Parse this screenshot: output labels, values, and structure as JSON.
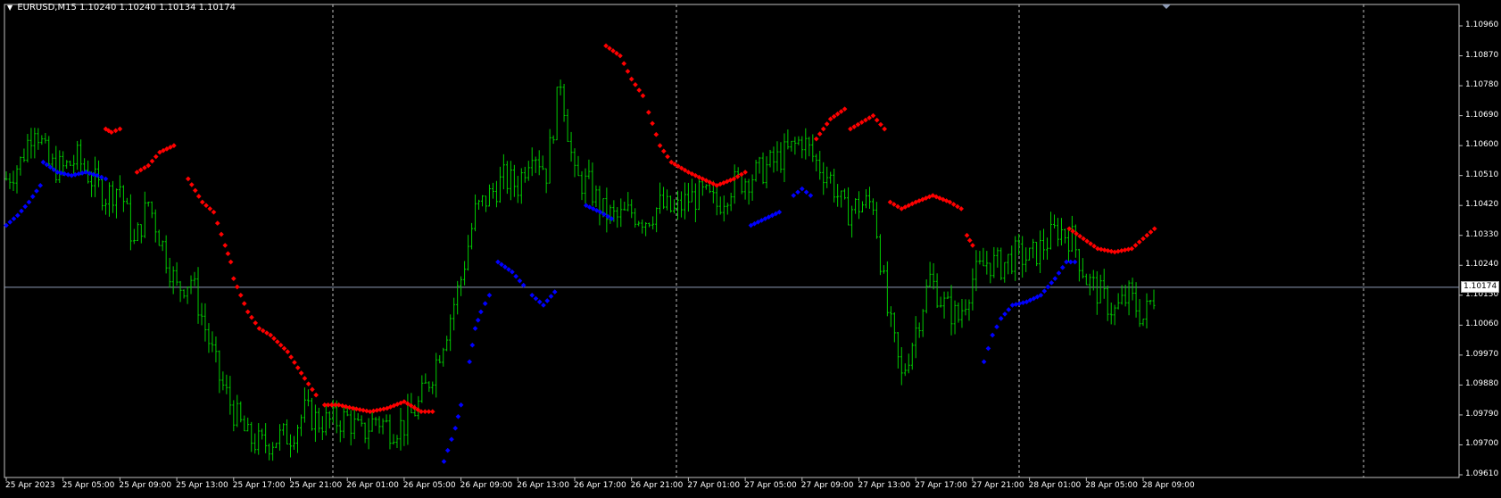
{
  "header": {
    "symbol_timeframe": "EURUSD,M15",
    "ohlc": "1.10240 1.10240 1.10134 1.10174"
  },
  "colors": {
    "background": "#000000",
    "frame": "#c0c0c0",
    "grid": "#c0c0c0",
    "bull_bars": "#00cc00",
    "dots_above": "#ff0000",
    "dots_below": "#0000ff",
    "price_line": "#8e9bb5"
  },
  "icons": {
    "collapse": "triangle-down-icon",
    "shift_marker": "triangle-down-icon"
  },
  "current_price": "1.10174",
  "price_axis": [
    "1.10960",
    "1.10870",
    "1.10780",
    "1.10690",
    "1.10600",
    "1.10510",
    "1.10420",
    "1.10330",
    "1.10240",
    "1.10150",
    "1.10060",
    "1.09970",
    "1.09880",
    "1.09790",
    "1.09700",
    "1.09610"
  ],
  "time_axis": [
    "25 Apr 2023",
    "25 Apr 05:00",
    "25 Apr 09:00",
    "25 Apr 13:00",
    "25 Apr 17:00",
    "25 Apr 21:00",
    "26 Apr 01:00",
    "26 Apr 05:00",
    "26 Apr 09:00",
    "26 Apr 13:00",
    "26 Apr 17:00",
    "26 Apr 21:00",
    "27 Apr 01:00",
    "27 Apr 05:00",
    "27 Apr 09:00",
    "27 Apr 13:00",
    "27 Apr 17:00",
    "27 Apr 21:00",
    "28 Apr 01:00",
    "28 Apr 05:00",
    "28 Apr 09:00"
  ],
  "chart_data": {
    "type": "line",
    "title": "EURUSD,M15",
    "ylim": [
      1.0961,
      1.1099
    ],
    "grid": false,
    "close_series": [
      {
        "t": 0,
        "v": 1.105
      },
      {
        "t": 0.5,
        "v": 1.1055
      },
      {
        "t": 1,
        "v": 1.1067
      },
      {
        "t": 1.5,
        "v": 1.1054
      },
      {
        "t": 2,
        "v": 1.1053
      },
      {
        "t": 2.5,
        "v": 1.1056
      },
      {
        "t": 3,
        "v": 1.105
      },
      {
        "t": 3.5,
        "v": 1.1045
      },
      {
        "t": 4,
        "v": 1.1048
      },
      {
        "t": 4.5,
        "v": 1.103
      },
      {
        "t": 5,
        "v": 1.1043
      },
      {
        "t": 5.5,
        "v": 1.103
      },
      {
        "t": 6,
        "v": 1.1017
      },
      {
        "t": 6.5,
        "v": 1.102
      },
      {
        "t": 7,
        "v": 1.1005
      },
      {
        "t": 7.5,
        "v": 1.099
      },
      {
        "t": 8,
        "v": 1.098
      },
      {
        "t": 8.5,
        "v": 1.0972
      },
      {
        "t": 9,
        "v": 1.097
      },
      {
        "t": 9.5,
        "v": 1.0972
      },
      {
        "t": 10,
        "v": 1.0973
      },
      {
        "t": 10.5,
        "v": 1.098
      },
      {
        "t": 11,
        "v": 1.0977
      },
      {
        "t": 11.5,
        "v": 1.0977
      },
      {
        "t": 12,
        "v": 1.0978
      },
      {
        "t": 12.5,
        "v": 1.0973
      },
      {
        "t": 13,
        "v": 1.0978
      },
      {
        "t": 13.5,
        "v": 1.0975
      },
      {
        "t": 14,
        "v": 1.0976
      },
      {
        "t": 14.5,
        "v": 1.0982
      },
      {
        "t": 15,
        "v": 1.0992
      },
      {
        "t": 15.5,
        "v": 1.1005
      },
      {
        "t": 16,
        "v": 1.102
      },
      {
        "t": 16.5,
        "v": 1.104
      },
      {
        "t": 17,
        "v": 1.1045
      },
      {
        "t": 17.5,
        "v": 1.105
      },
      {
        "t": 18,
        "v": 1.1048
      },
      {
        "t": 18.5,
        "v": 1.106
      },
      {
        "t": 19,
        "v": 1.1052
      },
      {
        "t": 19.5,
        "v": 1.108
      },
      {
        "t": 20,
        "v": 1.105
      },
      {
        "t": 20.5,
        "v": 1.1048
      },
      {
        "t": 21,
        "v": 1.104
      },
      {
        "t": 21.5,
        "v": 1.1038
      },
      {
        "t": 22,
        "v": 1.104
      },
      {
        "t": 22.5,
        "v": 1.1038
      },
      {
        "t": 23,
        "v": 1.1042
      },
      {
        "t": 23.5,
        "v": 1.104
      },
      {
        "t": 24,
        "v": 1.1044
      },
      {
        "t": 24.5,
        "v": 1.1045
      },
      {
        "t": 25,
        "v": 1.1042
      },
      {
        "t": 25.5,
        "v": 1.1048
      },
      {
        "t": 26,
        "v": 1.105
      },
      {
        "t": 26.5,
        "v": 1.1052
      },
      {
        "t": 27,
        "v": 1.1055
      },
      {
        "t": 27.5,
        "v": 1.1058
      },
      {
        "t": 28,
        "v": 1.1062
      },
      {
        "t": 28.5,
        "v": 1.1055
      },
      {
        "t": 29,
        "v": 1.105
      },
      {
        "t": 29.5,
        "v": 1.104
      },
      {
        "t": 30,
        "v": 1.1042
      },
      {
        "t": 30.5,
        "v": 1.1043
      },
      {
        "t": 31,
        "v": 1.101
      },
      {
        "t": 31.5,
        "v": 1.099
      },
      {
        "t": 32,
        "v": 1.1005
      },
      {
        "t": 32.5,
        "v": 1.102
      },
      {
        "t": 33,
        "v": 1.1012
      },
      {
        "t": 33.5,
        "v": 1.1008
      },
      {
        "t": 34,
        "v": 1.102
      },
      {
        "t": 34.5,
        "v": 1.1025
      },
      {
        "t": 35,
        "v": 1.1024
      },
      {
        "t": 35.5,
        "v": 1.1027
      },
      {
        "t": 36,
        "v": 1.1026
      },
      {
        "t": 36.5,
        "v": 1.103
      },
      {
        "t": 37,
        "v": 1.1035
      },
      {
        "t": 37.5,
        "v": 1.1032
      },
      {
        "t": 38,
        "v": 1.102
      },
      {
        "t": 38.5,
        "v": 1.1015
      },
      {
        "t": 39,
        "v": 1.101
      },
      {
        "t": 39.5,
        "v": 1.1015
      },
      {
        "t": 40,
        "v": 1.1008
      },
      {
        "t": 40.5,
        "v": 1.1017
      }
    ],
    "upper_dots": [
      [
        [
          3.5,
          1.1065
        ],
        [
          3.7,
          1.1064
        ],
        [
          4,
          1.1065
        ]
      ],
      [
        [
          4.6,
          1.1052
        ],
        [
          5,
          1.1054
        ],
        [
          5.4,
          1.1058
        ],
        [
          5.9,
          1.106
        ]
      ],
      [
        [
          6.4,
          1.105
        ],
        [
          6.9,
          1.1043
        ],
        [
          7.3,
          1.104
        ],
        [
          7.7,
          1.103
        ],
        [
          7.9,
          1.1025
        ]
      ],
      [
        [
          8.0,
          1.102
        ],
        [
          8.5,
          1.101
        ],
        [
          8.9,
          1.1005
        ],
        [
          9.3,
          1.1003
        ],
        [
          9.9,
          1.0998
        ],
        [
          10.5,
          1.099
        ],
        [
          10.9,
          1.0985
        ]
      ],
      [
        [
          11.2,
          1.0982
        ],
        [
          11.7,
          1.0982
        ],
        [
          12.2,
          1.0981
        ],
        [
          12.8,
          1.098
        ],
        [
          13.4,
          1.0981
        ],
        [
          14.0,
          1.0983
        ],
        [
          14.6,
          1.098
        ],
        [
          15.0,
          1.098
        ]
      ],
      [
        [
          21.1,
          1.109
        ],
        [
          21.6,
          1.1087
        ],
        [
          22.0,
          1.108
        ],
        [
          22.4,
          1.1075
        ]
      ],
      [
        [
          22.6,
          1.107
        ],
        [
          23.0,
          1.106
        ],
        [
          23.4,
          1.1055
        ],
        [
          24.0,
          1.1052
        ],
        [
          24.5,
          1.105
        ],
        [
          25.0,
          1.1048
        ],
        [
          25.6,
          1.105
        ],
        [
          26.0,
          1.1052
        ]
      ],
      [
        [
          28.5,
          1.1062
        ],
        [
          29.0,
          1.1068
        ],
        [
          29.5,
          1.1071
        ]
      ],
      [
        [
          29.7,
          1.1065
        ],
        [
          30.1,
          1.1067
        ],
        [
          30.5,
          1.1069
        ],
        [
          30.9,
          1.1065
        ]
      ],
      [
        [
          31.1,
          1.1043
        ],
        [
          31.5,
          1.1041
        ],
        [
          32.0,
          1.1043
        ],
        [
          32.6,
          1.1045
        ],
        [
          33.2,
          1.1043
        ],
        [
          33.6,
          1.1041
        ]
      ],
      [
        [
          33.8,
          1.1033
        ],
        [
          34.0,
          1.103
        ]
      ],
      [
        [
          37.4,
          1.1035
        ],
        [
          37.9,
          1.1032
        ],
        [
          38.4,
          1.1029
        ],
        [
          39.0,
          1.1028
        ],
        [
          39.6,
          1.1029
        ],
        [
          40.0,
          1.1032
        ],
        [
          40.4,
          1.1035
        ]
      ]
    ],
    "lower_dots": [
      [
        [
          0,
          1.1036
        ],
        [
          0.4,
          1.1039
        ],
        [
          0.8,
          1.1043
        ],
        [
          1.2,
          1.1048
        ]
      ],
      [
        [
          1.3,
          1.1055
        ],
        [
          1.8,
          1.1052
        ],
        [
          2.3,
          1.1051
        ],
        [
          2.8,
          1.1052
        ],
        [
          3.2,
          1.1051
        ],
        [
          3.5,
          1.105
        ]
      ],
      [
        [
          15.4,
          1.0965
        ],
        [
          15.8,
          1.0975
        ],
        [
          16.0,
          1.0982
        ]
      ],
      [
        [
          16.3,
          1.0995
        ],
        [
          16.5,
          1.1005
        ],
        [
          16.7,
          1.101
        ],
        [
          17.0,
          1.1015
        ]
      ],
      [
        [
          17.3,
          1.1025
        ],
        [
          17.8,
          1.1022
        ],
        [
          18.2,
          1.1018
        ]
      ],
      [
        [
          18.5,
          1.1015
        ],
        [
          18.9,
          1.1012
        ],
        [
          19.3,
          1.1016
        ]
      ],
      [
        [
          20.4,
          1.1042
        ],
        [
          20.9,
          1.104
        ],
        [
          21.3,
          1.1038
        ]
      ],
      [
        [
          26.2,
          1.1036
        ],
        [
          26.7,
          1.1038
        ],
        [
          27.2,
          1.104
        ]
      ],
      [
        [
          27.7,
          1.1045
        ],
        [
          28.0,
          1.1047
        ],
        [
          28.3,
          1.1045
        ]
      ],
      [
        [
          34.4,
          1.0995
        ],
        [
          34.7,
          1.1003
        ],
        [
          35.0,
          1.1008
        ],
        [
          35.4,
          1.1012
        ],
        [
          35.9,
          1.1013
        ],
        [
          36.4,
          1.1015
        ],
        [
          36.9,
          1.102
        ],
        [
          37.3,
          1.1025
        ],
        [
          37.6,
          1.1025
        ]
      ]
    ]
  }
}
